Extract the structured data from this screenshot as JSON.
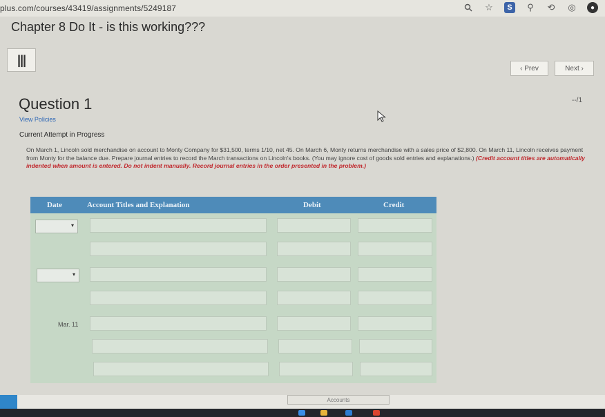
{
  "browser": {
    "url": "plus.com/courses/43419/assignments/5249187",
    "icons": [
      "search-icon",
      "star-icon",
      "s-extension-icon",
      "extension-icon",
      "refresh-extension-icon",
      "record-icon",
      "profile-icon"
    ]
  },
  "header": {
    "title": "Chapter 8 Do It - is this working???",
    "prev_label": "‹ Prev",
    "next_label": "Next ›"
  },
  "question": {
    "title": "Question 1",
    "score": "--/1",
    "view_policies": "View Policies",
    "attempt_status": "Current Attempt in Progress",
    "text": "On March 1, Lincoln sold merchandise on account to Monty Company for $31,500, terms 1/10, net 45. On March 6, Monty returns merchandise with a sales price of $2,800. On March 11, Lincoln receives payment from Monty for the balance due. Prepare journal entries to record the March transactions on Lincoln's books. (You may ignore cost of goods sold entries and explanations.)",
    "instructions": "(Credit account titles are automatically indented when amount is entered. Do not indent manually. Record journal entries in the order presented in the problem.)"
  },
  "journal": {
    "headers": {
      "date": "Date",
      "account": "Account Titles and Explanation",
      "debit": "Debit",
      "credit": "Credit"
    },
    "row3_date": "Mar. 11"
  },
  "footer": {
    "accounts_label": "Accounts"
  },
  "colors": {
    "table_header": "#4e8bb9",
    "table_body": "#c6d8c6",
    "instruction_red": "#c0282d",
    "link_blue": "#2d66b5"
  }
}
